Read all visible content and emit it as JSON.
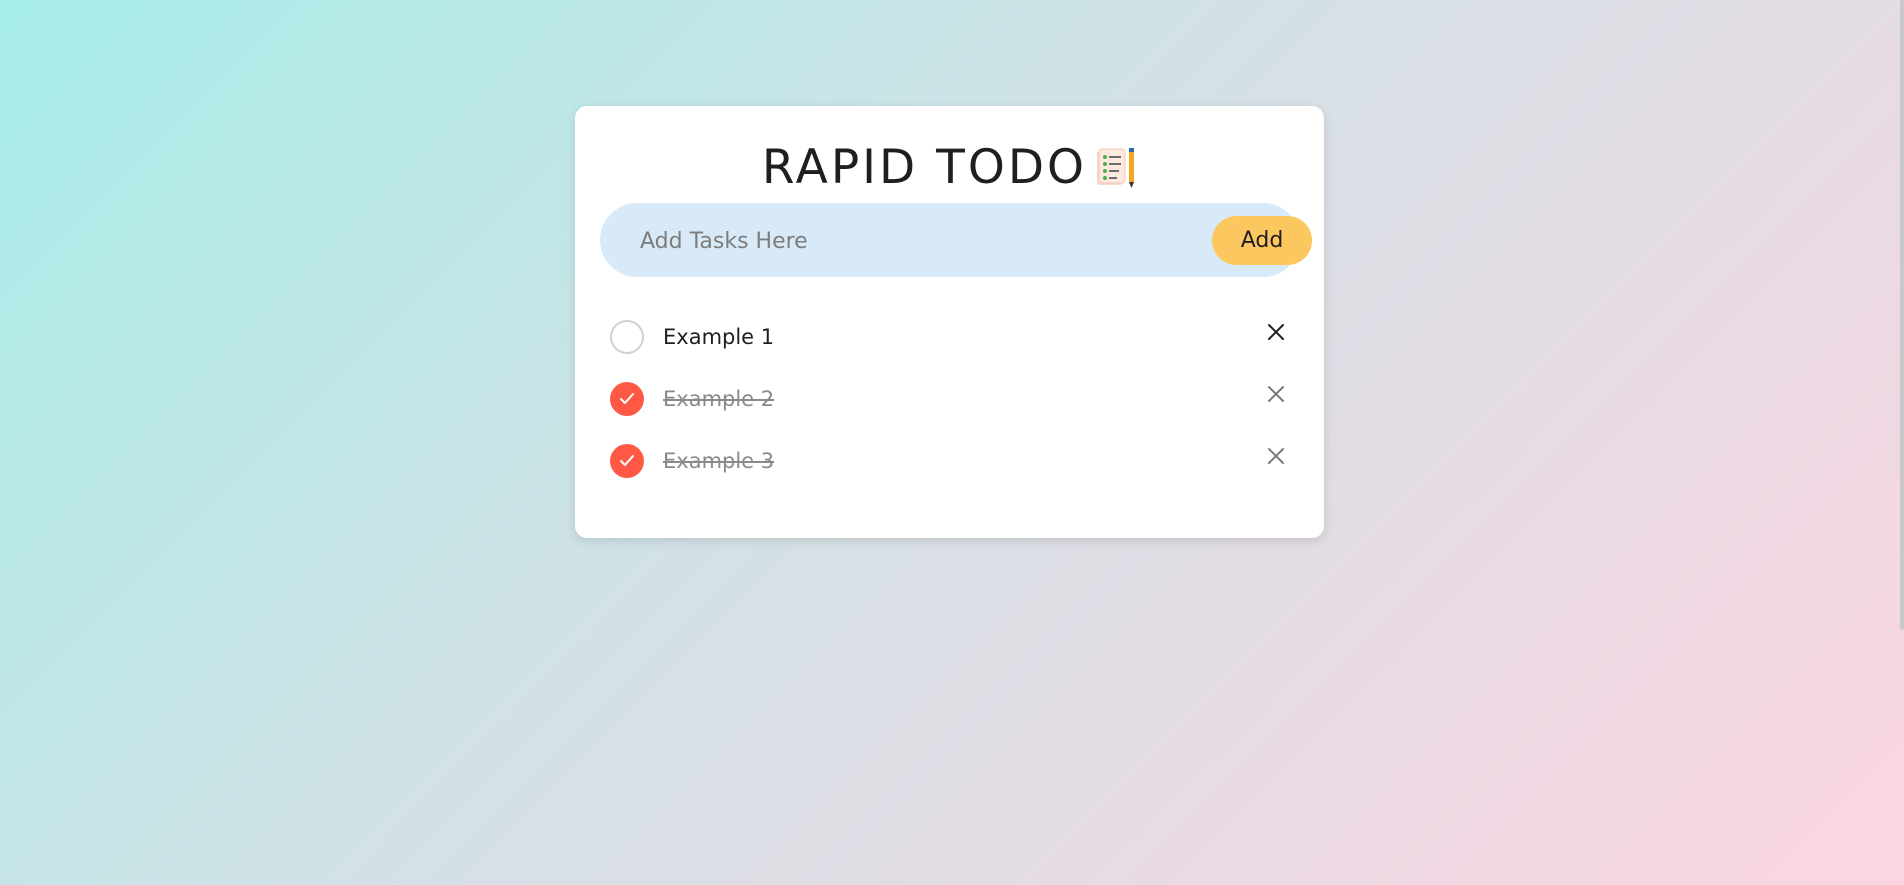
{
  "app": {
    "title": "RAPID TODO",
    "title_icon": "notepad-pencil-icon"
  },
  "input": {
    "placeholder": "Add Tasks Here",
    "value": "",
    "add_label": "Add"
  },
  "tasks": [
    {
      "label": "Example 1",
      "done": false
    },
    {
      "label": "Example 2",
      "done": true
    },
    {
      "label": "Example 3",
      "done": true
    }
  ],
  "colors": {
    "accent": "#fdc75f",
    "check": "#ff5945",
    "input_bg": "#d8eaf7"
  },
  "icons": {
    "check": "check-icon",
    "delete": "close-icon"
  }
}
